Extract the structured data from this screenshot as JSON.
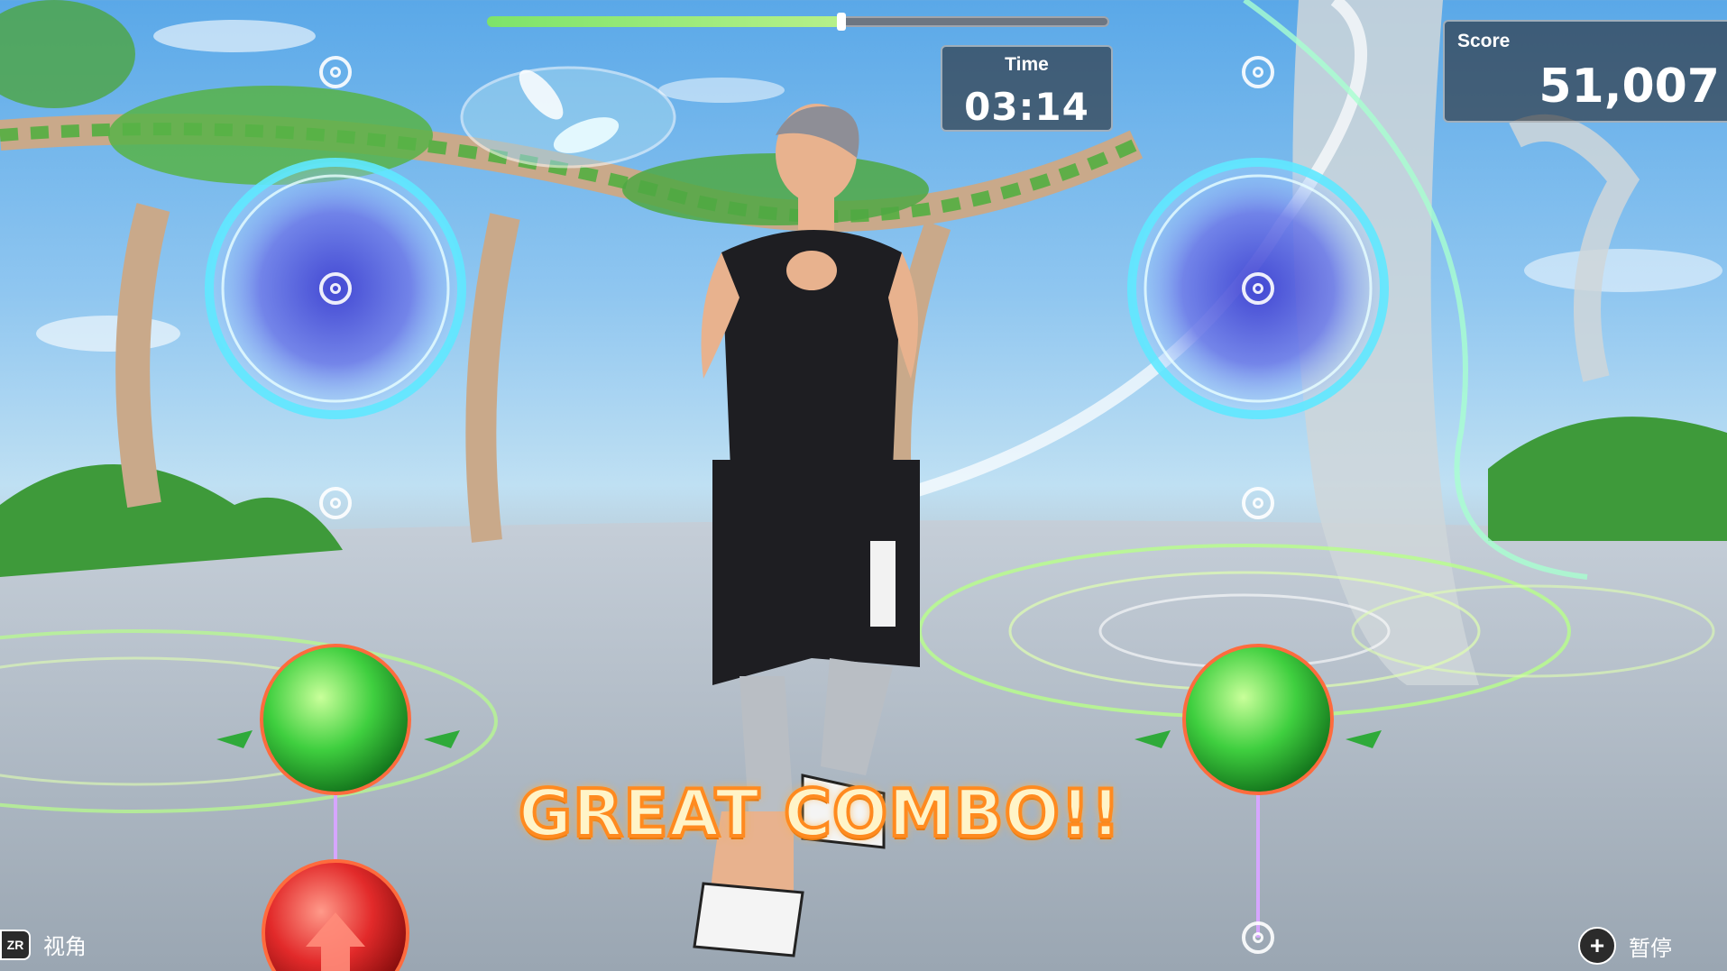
{
  "hud": {
    "progress": 0.57,
    "time_label": "Time",
    "time_value": "03:14",
    "score_label": "Score",
    "score_value": "51,007"
  },
  "feedback": {
    "combo_text": "GREAT COMBO!!"
  },
  "controls": {
    "camera_button": "ZR",
    "camera_label": "视角",
    "pause_button": "+",
    "pause_label": "暂停"
  },
  "colors": {
    "sky": "#5aa8e8",
    "ring_glow": "#5fe8ff",
    "green_orb": "#37c33e",
    "red_orb": "#e02a2a",
    "combo_stroke": "#ff8a1f"
  }
}
